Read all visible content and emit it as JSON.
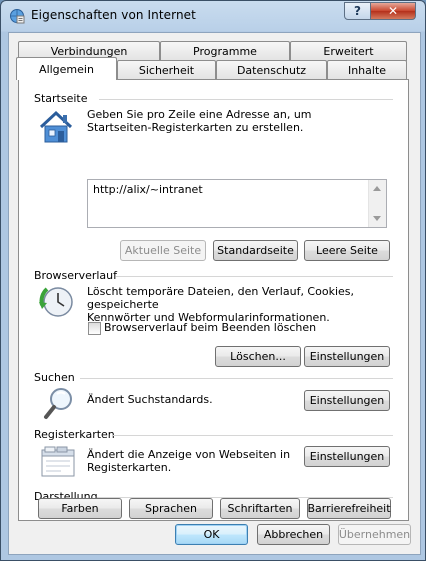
{
  "window": {
    "title": "Eigenschaften von Internet",
    "help_glyph": "?",
    "close_glyph": "✕"
  },
  "tabs": {
    "row1": [
      "Verbindungen",
      "Programme",
      "Erweitert"
    ],
    "row2": [
      "Allgemein",
      "Sicherheit",
      "Datenschutz",
      "Inhalte"
    ]
  },
  "startseite": {
    "title": "Startseite",
    "description": [
      "Geben Sie pro Zeile eine Adresse an, um",
      "Startseiten-Registerkarten zu erstellen."
    ],
    "url": "http://alix/~intranet",
    "btn_current": "Aktuelle Seite",
    "btn_default": "Standardseite",
    "btn_blank": "Leere Seite"
  },
  "browserverlauf": {
    "title": "Browserverlauf",
    "description": [
      "Löscht temporäre Dateien, den Verlauf, Cookies, gespeicherte",
      "Kennwörter und Webformularinformationen."
    ],
    "checkbox_label": "Browserverlauf beim Beenden löschen",
    "btn_delete": "Löschen...",
    "btn_settings": "Einstellungen"
  },
  "suchen": {
    "title": "Suchen",
    "description": "Ändert Suchstandards.",
    "btn_settings": "Einstellungen"
  },
  "registerkarten": {
    "title": "Registerkarten",
    "description": [
      "Ändert die Anzeige von Webseiten in",
      "Registerkarten."
    ],
    "btn_settings": "Einstellungen"
  },
  "darstellung": {
    "title": "Darstellung",
    "btn_colors": "Farben",
    "btn_languages": "Sprachen",
    "btn_fonts": "Schriftarten",
    "btn_accessibility": "Barrierefreiheit"
  },
  "footer": {
    "ok": "OK",
    "cancel": "Abbrechen",
    "apply": "Übernehmen"
  }
}
